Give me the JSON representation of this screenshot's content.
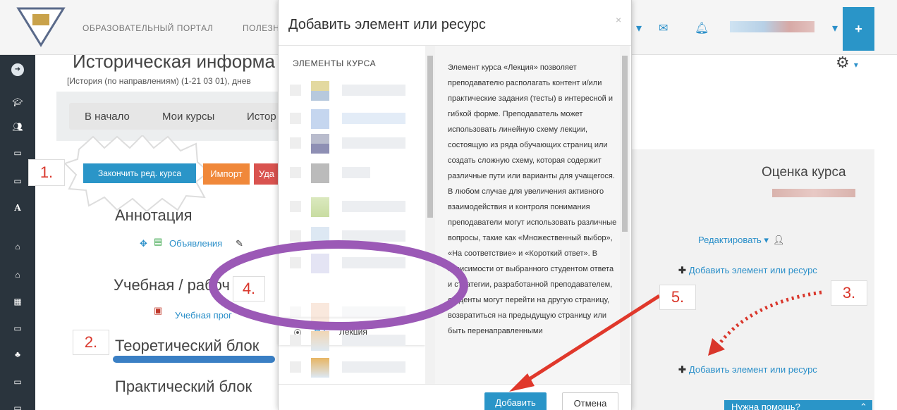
{
  "navbar": {
    "portal_label": "ОБРАЗОВАТЕЛЬНЫЙ ПОРТАЛ",
    "useful_label": "ПОЛЕЗН",
    "plus_label": "+"
  },
  "course": {
    "title": "Историческая информа",
    "subtitle": "[История (по направлениям) (1-21 03 01), днев"
  },
  "breadcrumb": [
    "В начало",
    "Мои курсы",
    "Истор"
  ],
  "buttons": {
    "finish_edit": "Закончить ред. курса",
    "import": "Импорт",
    "delete": "Уда"
  },
  "sections": {
    "annotation": "Аннотация",
    "announcements": "Объявления",
    "study_program_title": "Учебная / рабоч",
    "study_program_link": "Учебная прог",
    "theory_block": "Теоретический блок",
    "practice_block": "Практический блок"
  },
  "right_panel": {
    "rating_title": "Оценка курса",
    "edit_label": "Редактировать ▾",
    "add_label_1": "Добавить элемент или ресурс",
    "add_label_2": "Добавить элемент или ресурс",
    "help_label": "Нужна помощь?"
  },
  "modal": {
    "title": "Добавить элемент или ресурс",
    "close": "×",
    "elements_header": "ЭЛЕМЕНТЫ КУРСА",
    "selected_item": "Лекция",
    "description": "Элемент курса «Лекция» позволяет преподавателю располагать контент и/или практические задания (тесты) в интересной и гибкой форме. Преподаватель может использовать линейную схему лекции, состоящую из ряда обучающих страниц или создать сложную схему, которая содержит различные пути или варианты для учащегося. В любом случае для увеличения активного взаимодействия и контроля понимания преподаватели могут использовать различные вопросы, такие как «Множественный выбор», «На соответствие» и «Короткий ответ». В зависимости от выбранного студентом ответа и стратегии, разработанной преподавателем, студенты могут перейти на другую страницу, возвратиться на предыдущую страницу или быть перенаправленными",
    "add_button": "Добавить",
    "cancel_button": "Отмена"
  },
  "steps": {
    "s1": "1.",
    "s2": "2.",
    "s3": "3.",
    "s4": "4.",
    "s5": "5."
  },
  "colors": {
    "accent_blue": "#2a95c8",
    "annotation_red": "#d9362b",
    "ellipse_purple": "#9b59b6",
    "sidebar_dark": "#2a343d"
  }
}
